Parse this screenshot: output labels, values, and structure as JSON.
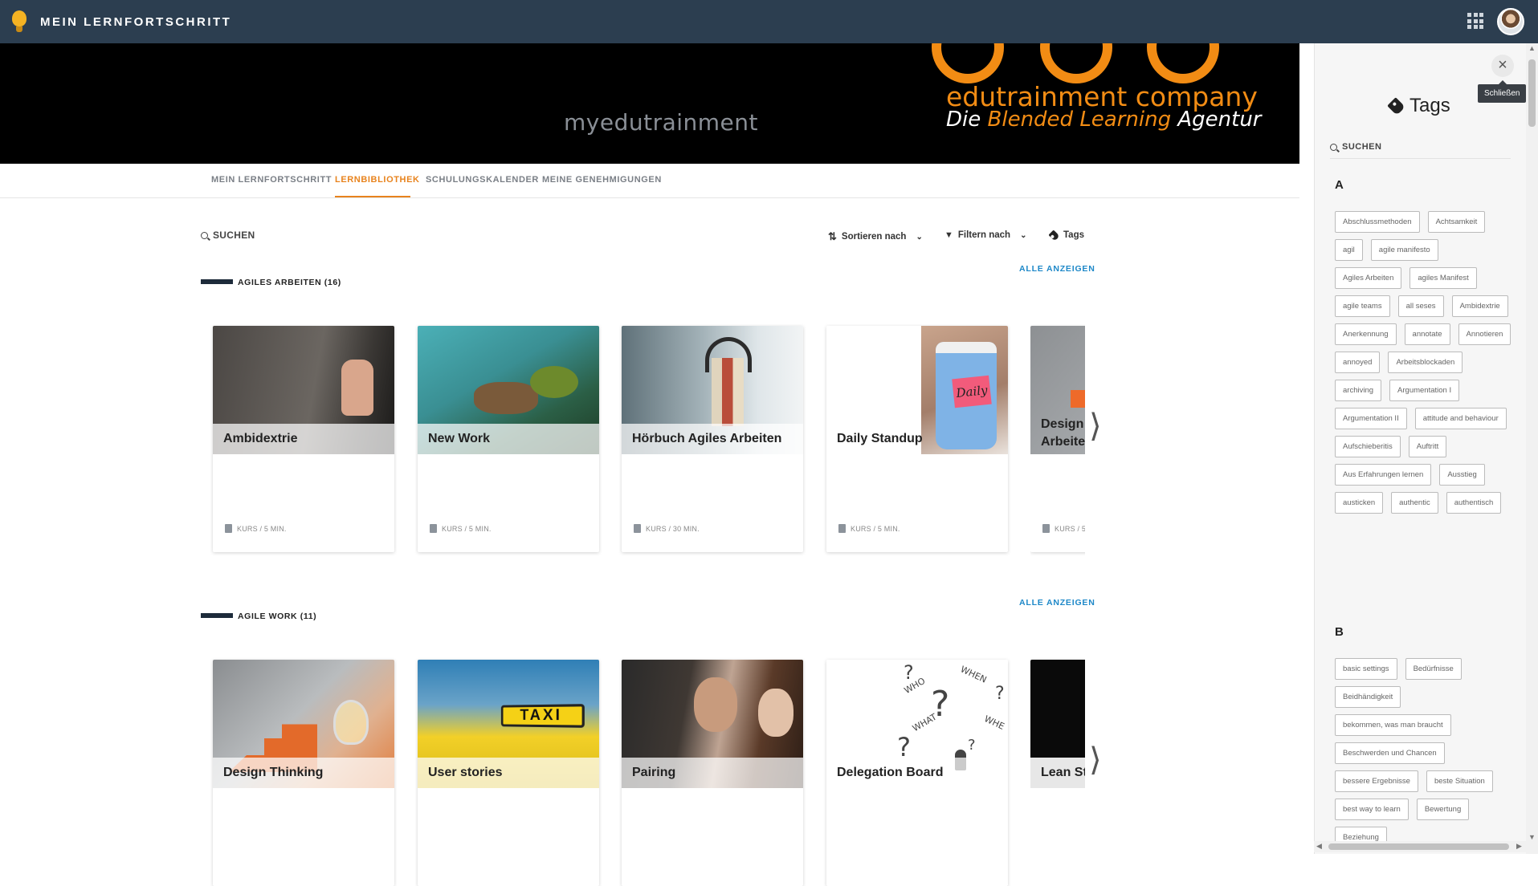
{
  "header": {
    "title": "MEIN LERNFORTSCHRITT"
  },
  "banner": {
    "brand": "myedutrainment",
    "company": "edutrainment company",
    "tagline_pre": "Die ",
    "tagline_orange": "Blended Learning",
    "tagline_post": " Agentur"
  },
  "nav": {
    "tabs": [
      {
        "label": "MEIN LERNFORTSCHRITT",
        "active": false
      },
      {
        "label": "LERNBIBLIOTHEK",
        "active": true
      },
      {
        "label": "SCHULUNGSKALENDER",
        "active": false
      },
      {
        "label": "MEINE GENEHMIGUNGEN",
        "active": false
      }
    ]
  },
  "toolbar": {
    "search_label": "SUCHEN",
    "sort_label": "Sortieren nach",
    "filter_label": "Filtern nach",
    "tags_label": "Tags"
  },
  "sections": [
    {
      "title": "AGILES ARBEITEN (16)",
      "show_all": "ALLE ANZEIGEN",
      "cards": [
        {
          "title": "Ambidextrie",
          "meta": "KURS / 5 MIN."
        },
        {
          "title": "New Work",
          "meta": "KURS / 5 MIN."
        },
        {
          "title": "Hörbuch Agiles Arbeiten",
          "meta": "KURS / 30 MIN."
        },
        {
          "title": "Daily Standup",
          "meta": "KURS / 5 MIN.",
          "sticky_note": "Daily"
        },
        {
          "title": "Design Arbeite",
          "meta": "KURS / 5"
        }
      ]
    },
    {
      "title": "AGILE WORK (11)",
      "show_all": "ALLE ANZEIGEN",
      "cards": [
        {
          "title": "Design Thinking"
        },
        {
          "title": "User stories",
          "sign": "TAXI"
        },
        {
          "title": "Pairing"
        },
        {
          "title": "Delegation Board",
          "words": [
            "WHO",
            "WHEN",
            "WHAT",
            "WHE"
          ]
        },
        {
          "title": "Lean St"
        }
      ]
    }
  ],
  "tags_panel": {
    "title": "Tags",
    "close_tooltip": "Schließen",
    "search_label": "SUCHEN",
    "groups": [
      {
        "letter": "A",
        "tags": [
          "Abschlussmethoden",
          "Achtsamkeit",
          "agil",
          "agile manifesto",
          "Agiles Arbeiten",
          "agiles Manifest",
          "agile teams",
          "all seses",
          "Ambidextrie",
          "Anerkennung",
          "annotate",
          "Annotieren",
          "annoyed",
          "Arbeitsblockaden",
          "archiving",
          "Argumentation I",
          "Argumentation II",
          "attitude and behaviour",
          "Aufschieberitis",
          "Auftritt",
          "Aus Erfahrungen lernen",
          "Ausstieg",
          "austicken",
          "authentic",
          "authentisch"
        ]
      },
      {
        "letter": "B",
        "tags": [
          "basic settings",
          "Bedürfnisse",
          "Beidhändigkeit",
          "bekommen, was man braucht",
          "Beschwerden und Chancen",
          "bessere Ergebnisse",
          "beste Situation",
          "best way to learn",
          "Bewertung",
          "Beziehung"
        ]
      }
    ]
  },
  "colors": {
    "accent": "#e8831d",
    "link": "#1e88c8",
    "topbar": "#2c3e50"
  }
}
